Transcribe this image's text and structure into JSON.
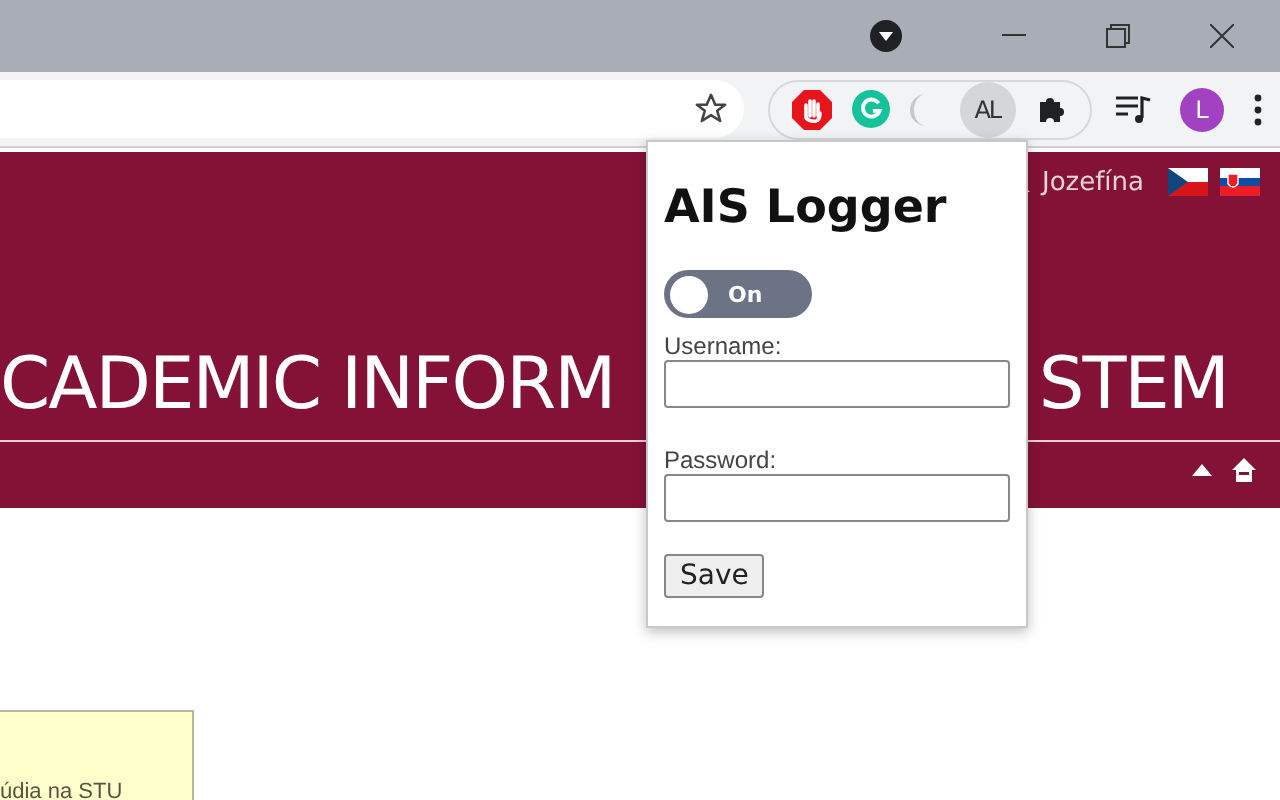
{
  "browser": {
    "extension_label": "AL",
    "profile_initial": "L"
  },
  "page": {
    "user_name": "Jozefína",
    "title_left": "CADEMIC INFORM",
    "title_right": "STEM",
    "notice_text": "údia na STU"
  },
  "popup": {
    "title": "AIS Logger",
    "toggle": {
      "label": "On",
      "on": true
    },
    "fields": [
      {
        "label": "Username:"
      },
      {
        "label": "Password:"
      }
    ],
    "save_button": "Save"
  }
}
